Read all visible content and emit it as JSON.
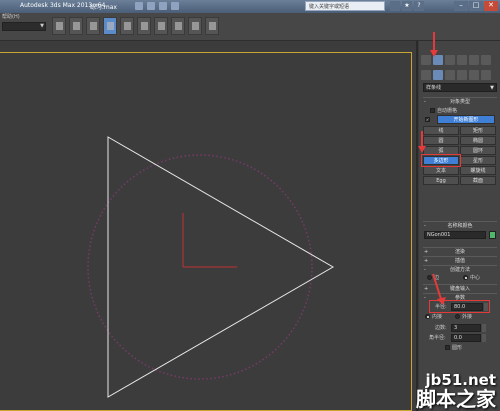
{
  "titlebar": {
    "app_title": "Autodesk 3ds Max  2013 x64",
    "file_title": "练习.max",
    "search_placeholder": "键入关键字或短语",
    "minimize": "–",
    "maximize": "□",
    "close": "✕"
  },
  "toolbar": {
    "help_label": "帮助(H)"
  },
  "panel": {
    "category_dropdown": "样条线",
    "object_type": {
      "header": "对象类型",
      "autogrid_label": "自动栅格",
      "start_new_shape": "开始新图形",
      "buttons": [
        "线",
        "矩形",
        "圆",
        "椭圆",
        "弧",
        "圆环",
        "多边形",
        "星形",
        "文本",
        "螺旋线",
        "Egg",
        "截面"
      ]
    },
    "name_color": {
      "header": "名称和颜色",
      "name_value": "NGon001"
    },
    "rollouts": {
      "render": "渲染",
      "interp": "插值",
      "create_method": "创建方法",
      "edge": "边",
      "center": "中心",
      "keyboard": "键盘输入",
      "params": "参数"
    },
    "params": {
      "radius_label": "半径:",
      "radius_value": "80.0",
      "inscribed": "内接",
      "circumscribed": "外接",
      "sides_label": "边数:",
      "sides_value": "3",
      "corner_label": "角半径:",
      "corner_value": "0.0",
      "circular_label": "圆形"
    }
  },
  "watermark": {
    "site": "jb51.net",
    "cn": "脚本之家"
  },
  "colors": {
    "viewport_bg": "#3c3c3c",
    "triangle": "#e8e8e8",
    "dotted_circle": "#7a3a6a",
    "highlight": "#e53a3a",
    "active_blue": "#3f7fd6"
  }
}
